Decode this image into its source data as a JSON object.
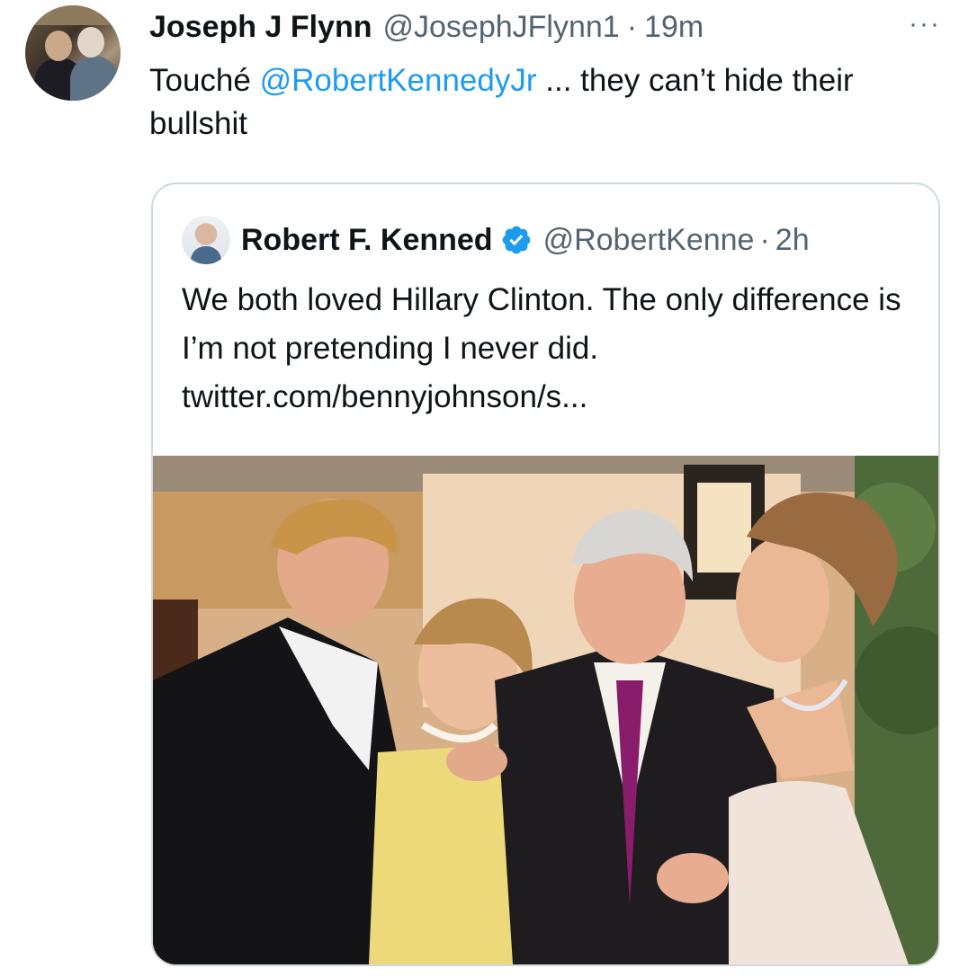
{
  "tweet": {
    "author_name": "Joseph J Flynn",
    "author_handle": "@JosephJFlynn1",
    "separator": "·",
    "time": "19m",
    "more_icon": "···",
    "text_before": "Touché ",
    "mention": "@RobertKennedyJr",
    "text_after": " ... they can’t hide their bullshit"
  },
  "quoted_tweet": {
    "author_name": "Robert F. Kenned",
    "author_handle": "@RobertKenne",
    "separator": "·",
    "time": "2h",
    "verified_icon": "verified-badge-icon",
    "text": "We both loved Hillary Clinton. The only difference is I’m not pretending I never did.",
    "link": "twitter.com/bennyjohnson/s..."
  },
  "colors": {
    "link_blue": "#1d9bf0",
    "secondary_text": "#536471",
    "border": "#cfd9de",
    "verified": "#1d9bf0"
  }
}
